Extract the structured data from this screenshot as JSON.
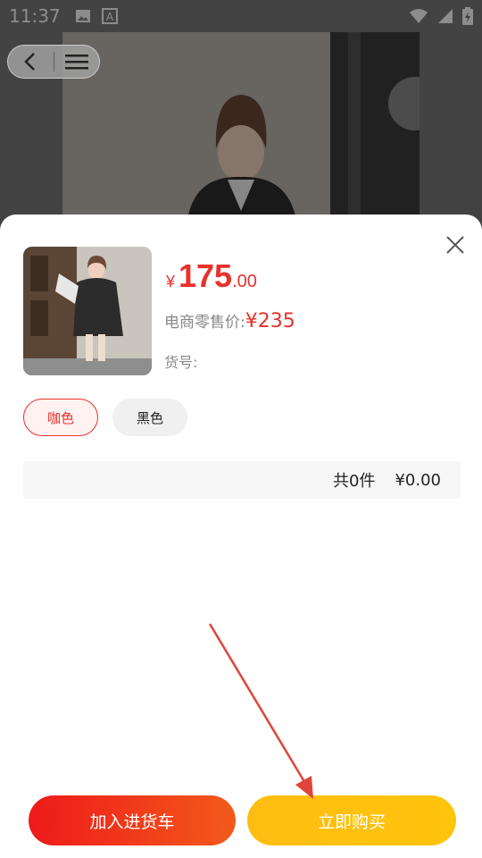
{
  "status_bar": {
    "time": "11:37",
    "icons": [
      "image-icon",
      "text-icon",
      "wifi-icon",
      "signal-icon",
      "battery-charging-icon"
    ]
  },
  "nav": {
    "icons": [
      "back-chevron-icon",
      "menu-icon"
    ]
  },
  "product": {
    "price_symbol": "¥",
    "price_int": "175",
    "price_dec": ".00",
    "retail_label": "电商零售价:",
    "retail_value": "¥235",
    "sku_label": "货号:"
  },
  "colors": {
    "options": [
      "咖色",
      "黑色"
    ],
    "selected": "咖色"
  },
  "summary": {
    "count": "共0件",
    "total": "¥0.00"
  },
  "actions": {
    "add_cart": "加入进货车",
    "buy_now": "立即购买"
  },
  "theme": {
    "accent_red": "#e8312b",
    "accent_yellow": "#ffc40c"
  }
}
